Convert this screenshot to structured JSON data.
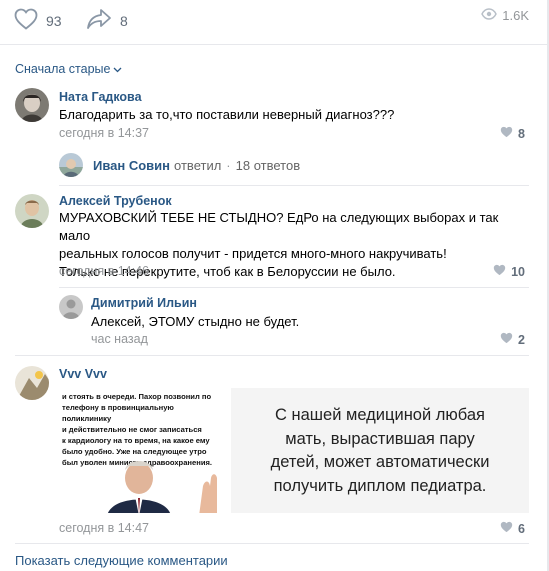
{
  "post_actions": {
    "likes": "93",
    "shares": "8",
    "views": "1.6K"
  },
  "sort_label": "Сначала старые",
  "comments": [
    {
      "author": "Ната Гадкова",
      "text": "Благодарить за то,что поставили неверный диагноз???",
      "date": "сегодня в 14:37",
      "likes": "8",
      "replies": {
        "author": "Иван Совин",
        "action": "ответил",
        "separator": "·",
        "count": "18 ответов"
      }
    },
    {
      "author": "Алексей Трубенок",
      "text": "МУРАХОВСКИЙ ТЕБЕ НЕ СТЫДНО? ЕдРо на следующих выборах и так мало\nреальных голосов получит - придется много-много накручивать!\nТолько не перекрутите, чтоб как в Белоруссии не было.",
      "date": "сегодня в 14:46",
      "likes": "10",
      "reply": {
        "author": "Димитрий Ильин",
        "text": "Алексей, ЭТОМУ стыдно не будет.",
        "date": "час назад",
        "likes": "2"
      }
    },
    {
      "author": "Vvv Vvv",
      "date": "сегодня в 14:47",
      "likes": "6",
      "attachment_left_text": "и стоять в очереди. Пахор позвонил по\nтелефону в провинциальную поликлинику\nи действительно не смог записаться\nк кардиологу на то время, на какое ему\nбыло удобно. Уже на следующее утро\nбыл уволен министр здравоохранения.",
      "attachment_right_text": "С нашей медициной любая\nмать, вырастившая пару\nдетей, может автоматически\nполучить диплом педиатра."
    }
  ],
  "show_more_label": "Показать следующие комментарии",
  "colors": {
    "link": "#2a5885",
    "muted": "#939699",
    "icon": "#626d7a",
    "divider": "#e7e8ec"
  },
  "icons": [
    "heart-icon",
    "share-arrow-icon",
    "eye-icon",
    "chevron-down-icon"
  ]
}
